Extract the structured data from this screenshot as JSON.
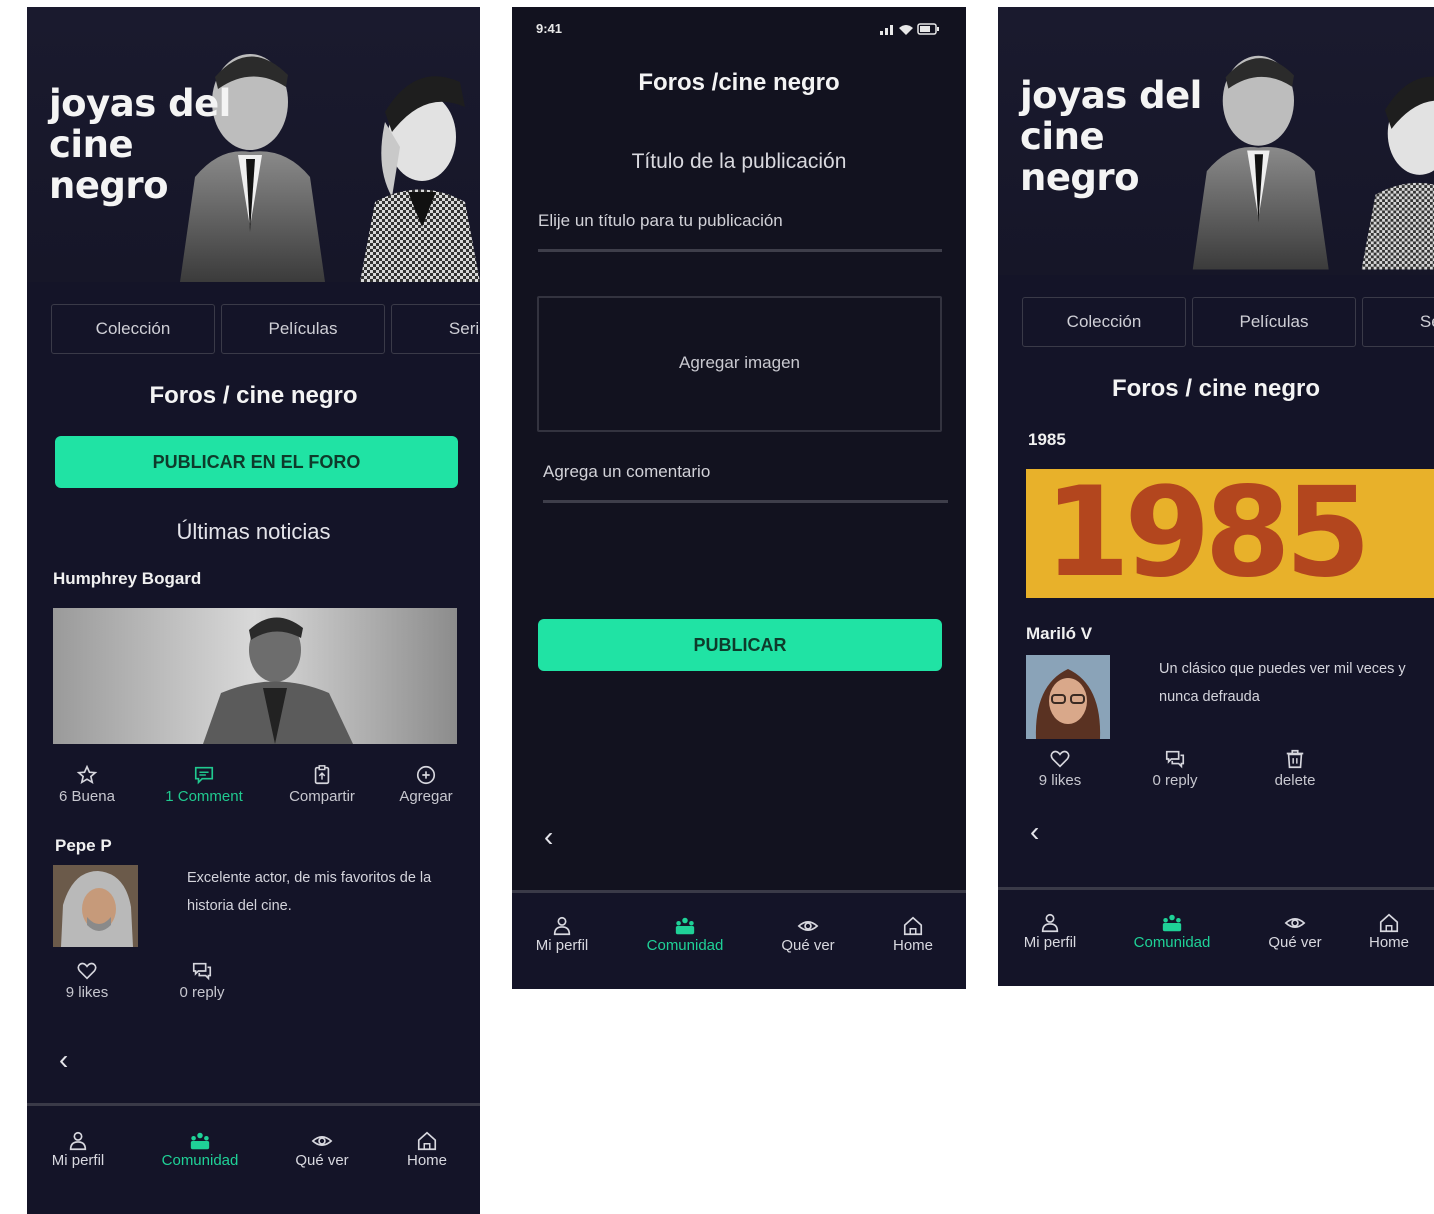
{
  "brand": {
    "hero_title": "joyas del cine negro",
    "accent_color": "#20e3a4",
    "background_color": "#141428"
  },
  "tabs": [
    "Colección",
    "Películas",
    "Series"
  ],
  "forum_title": "Foros / cine negro",
  "screen1": {
    "cta_label": "PUBLICAR EN EL FORO",
    "latest_news_label": "Últimas noticias",
    "post_author": "Humphrey Bogard",
    "post_actions": [
      {
        "icon": "star-icon",
        "label": "6 Buena"
      },
      {
        "icon": "comment-icon",
        "label": "1 Comment"
      },
      {
        "icon": "share-icon",
        "label": "Compartir"
      },
      {
        "icon": "add-circle-icon",
        "label": "Agregar"
      }
    ],
    "comment": {
      "author": "Pepe P",
      "text": "Excelente actor, de mis favoritos de la historia del cine.",
      "likes_label": "9 likes",
      "reply_label": "0 reply"
    }
  },
  "screen2": {
    "status_time": "9:41",
    "title": "Foros /cine negro",
    "title_field_label": "Título de la publicación",
    "title_field_placeholder": "Elije un título para tu publicación",
    "add_image_label": "Agregar imagen",
    "comment_placeholder": "Agrega un comentario",
    "publish_label": "PUBLICAR"
  },
  "screen3": {
    "post_title": "1985",
    "post_image_text": "1985",
    "comment": {
      "author": "Mariló V",
      "text": "Un clásico que puedes ver mil veces y nunca defrauda",
      "likes_label": "9 likes",
      "reply_label": "0 reply",
      "delete_label": "delete"
    }
  },
  "bottom_nav": [
    {
      "icon": "person-icon",
      "label": "Mi perfil"
    },
    {
      "icon": "community-icon",
      "label": "Comunidad",
      "active": true
    },
    {
      "icon": "eye-icon",
      "label": "Qué ver"
    },
    {
      "icon": "home-icon",
      "label": "Home"
    }
  ]
}
